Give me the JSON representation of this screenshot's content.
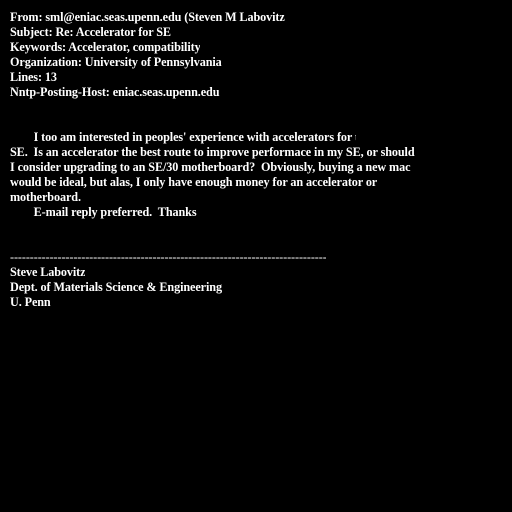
{
  "header": {
    "from": "From: sml@eniac.seas.upenn.edu (Steven M Labovitz",
    "subject": "Subject: Re: Accelerator for SE",
    "keywords": "Keywords: Accelerator, compatibility",
    "organization": "Organization: University of Pennsylvania",
    "lines": "Lines: 13",
    "nntp_host": "Nntp-Posting-Host: eniac.seas.upenn.edu"
  },
  "body": {
    "lines": [
      "\tI too am interested in peoples' experience with accelerators for the",
      "SE.  Is an accelerator the best route to improve performace in my SE, or should",
      "I consider upgrading to an SE/30 motherboard?  Obviously, buying a new mac",
      "would be ideal, but alas, I only have enough money for an accelerator or",
      "motherboard.",
      "\tE-mail reply preferred.  Thanks"
    ]
  },
  "signature": {
    "separator": "--------------------------------------------------------------------------------",
    "name": "Steve Labovitz",
    "dept": "Dept. of Materials Science & Engineering",
    "school": "U. Penn"
  }
}
